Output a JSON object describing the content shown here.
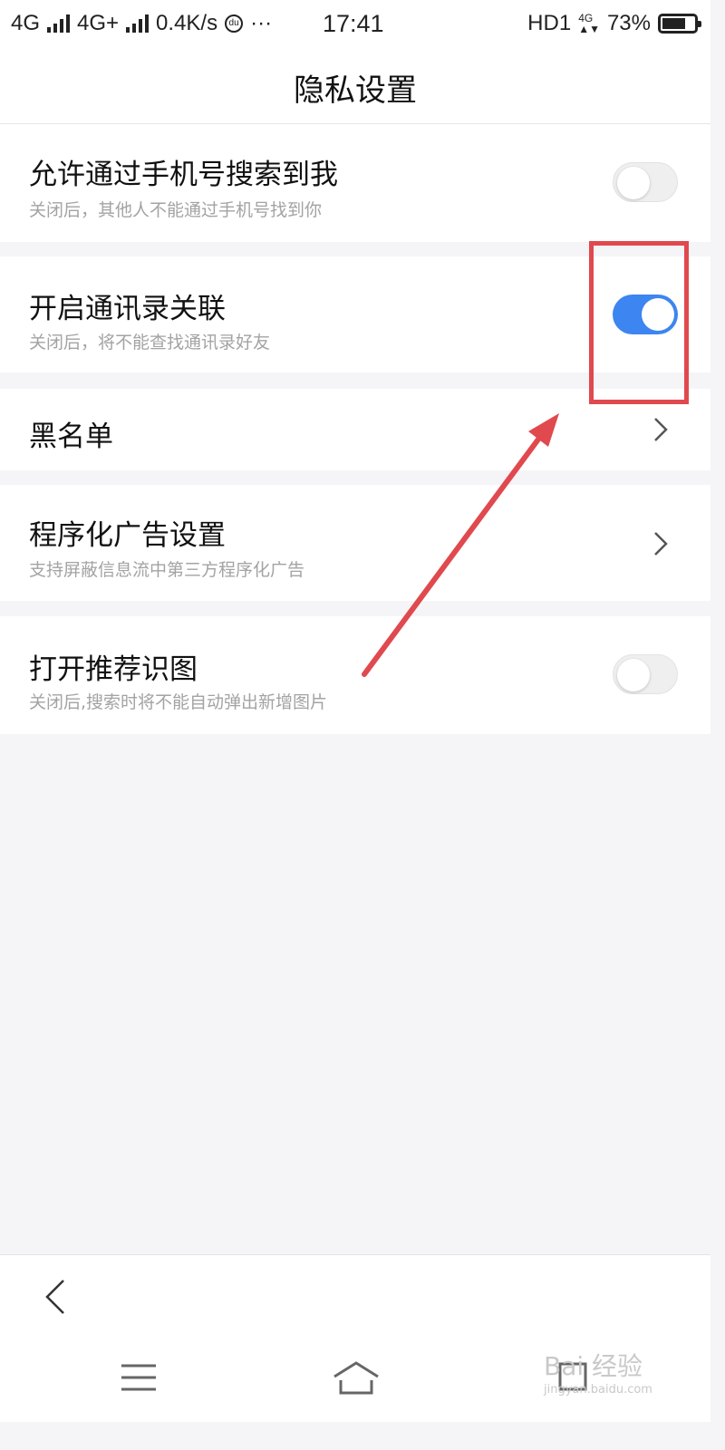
{
  "status_bar": {
    "network1": "4G",
    "network2": "4G+",
    "speed": "0.4K/s",
    "more": "···",
    "time": "17:41",
    "hd": "HD1",
    "net_small": "4G",
    "battery": "73%",
    "battery_level": 0.73
  },
  "header": {
    "title": "隐私设置"
  },
  "settings": [
    {
      "title": "允许通过手机号搜索到我",
      "subtitle": "关闭后，其他人不能通过手机号找到你",
      "control": "toggle",
      "on": false
    },
    {
      "title": "开启通讯录关联",
      "subtitle": "关闭后，将不能查找通讯录好友",
      "control": "toggle",
      "on": true
    },
    {
      "title": "黑名单",
      "control": "chevron"
    },
    {
      "title": "程序化广告设置",
      "subtitle": "支持屏蔽信息流中第三方程序化广告",
      "control": "chevron"
    },
    {
      "title": "打开推荐识图",
      "subtitle": "关闭后,搜索时将不能自动弹出新增图片",
      "control": "toggle",
      "on": false
    }
  ],
  "annotation": {
    "color": "#e0494e"
  },
  "colors": {
    "toggle_on": "#3d85f0",
    "background": "#f5f4f7"
  },
  "nav": {
    "icons": [
      "back-icon",
      "menu-icon",
      "home-icon",
      "recent-apps-icon"
    ]
  },
  "watermark": {
    "text": "Bai 经验",
    "sub": "jingyan.baidu.com"
  }
}
